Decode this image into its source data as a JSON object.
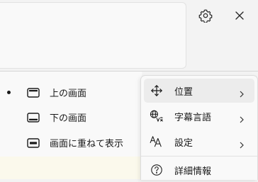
{
  "toolbar": {
    "settings_icon": "gear-icon",
    "close_icon": "close-icon"
  },
  "position_submenu": {
    "items": [
      {
        "label": "上の画面",
        "icon": "layout-top-icon",
        "selected": true
      },
      {
        "label": "下の画面",
        "icon": "layout-bottom-icon",
        "selected": false
      },
      {
        "label": "画面に重ねて表示",
        "icon": "layout-overlay-icon",
        "selected": false
      }
    ]
  },
  "context_menu": {
    "items": [
      {
        "label": "位置",
        "icon": "move-arrows-icon",
        "has_submenu": true,
        "highlighted": true
      },
      {
        "label": "字幕言語",
        "icon": "language-icon",
        "has_submenu": true,
        "highlighted": false
      },
      {
        "label": "設定",
        "icon": "font-size-icon",
        "has_submenu": true,
        "highlighted": false
      }
    ],
    "info": {
      "label": "詳細情報",
      "icon": "help-circle-icon"
    }
  },
  "colors": {
    "background": "#f3f3f3",
    "panel": "#f9f9f9",
    "highlight": "#ececec",
    "bottom_strip": "#fbf9ec",
    "text": "#1a1a1a"
  }
}
